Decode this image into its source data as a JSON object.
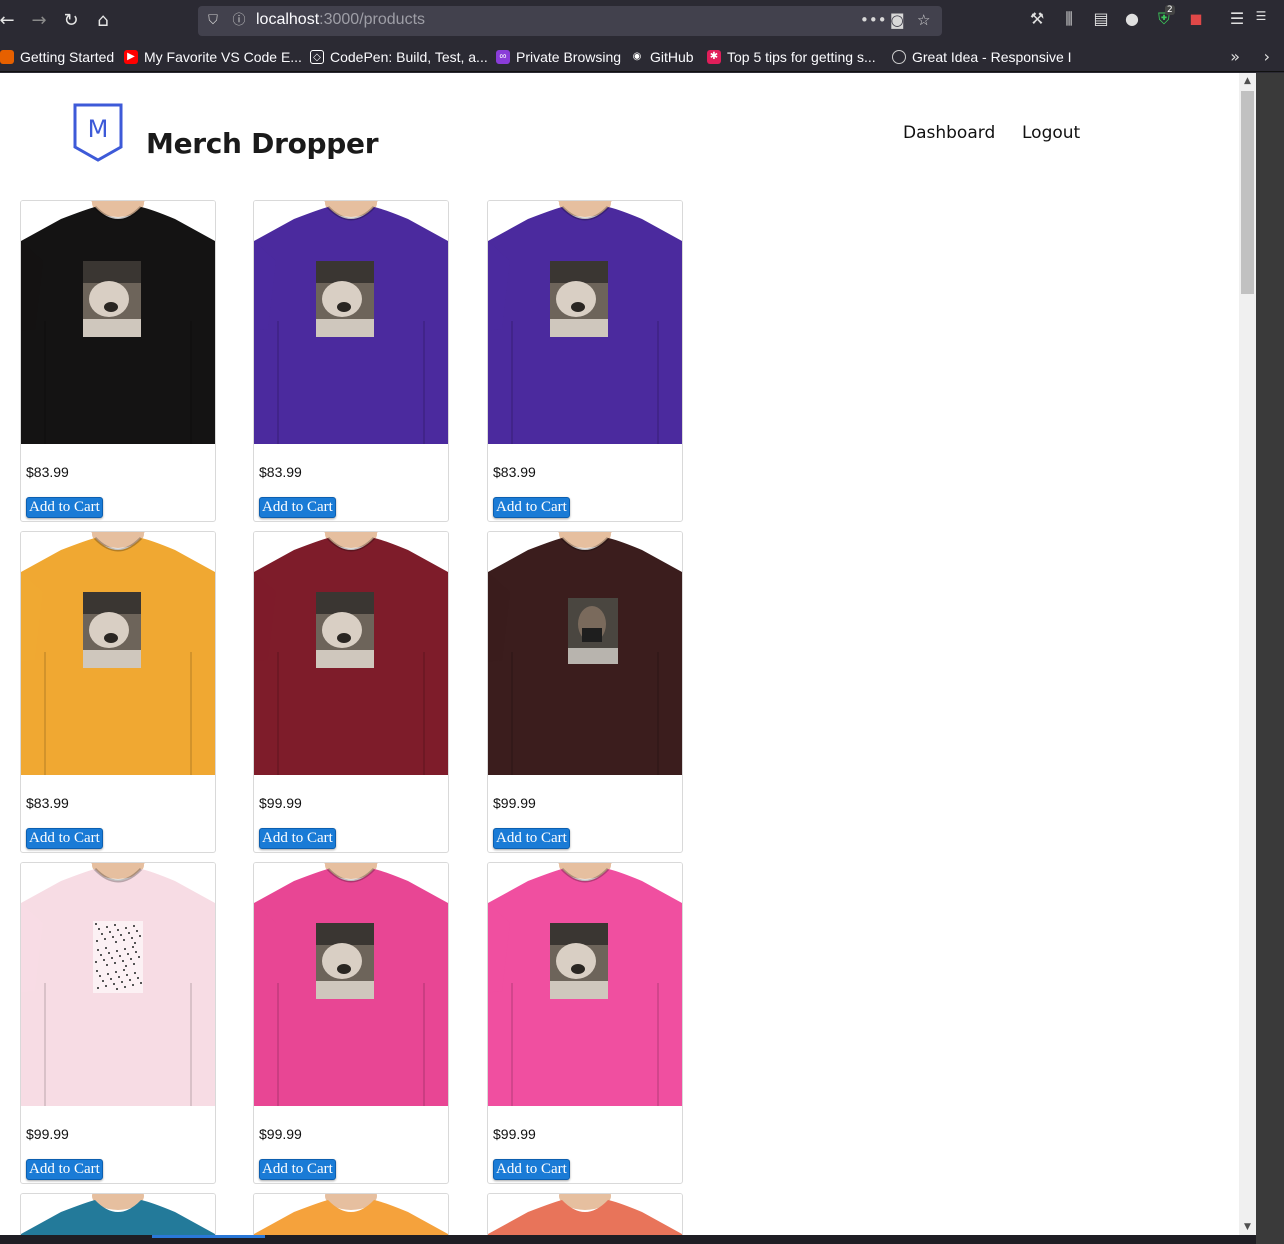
{
  "browser": {
    "url_host": "localhost",
    "url_path": ":3000/products",
    "extension_badge": "2",
    "bookmarks": [
      {
        "label": "Getting Started",
        "color": "#e66000"
      },
      {
        "label": "My Favorite VS Code E...",
        "color": "#ff0000"
      },
      {
        "label": "CodePen: Build, Test, a...",
        "color": "#ffffff"
      },
      {
        "label": "Private Browsing",
        "color": "#8a3cd8"
      },
      {
        "label": "GitHub",
        "color": "#ffffff"
      },
      {
        "label": "Top 5 tips for getting s...",
        "color": "#e01e5a"
      },
      {
        "label": "Great Idea - Responsive I",
        "color": "#cccccc"
      }
    ]
  },
  "header": {
    "logo_letter": "M",
    "brand": "Merch Dropper",
    "nav": [
      {
        "label": "Dashboard"
      },
      {
        "label": "Logout"
      }
    ]
  },
  "products": [
    {
      "price": "$83.99",
      "button": "Add to Cart",
      "shirt_color": "#141313",
      "design": "dog"
    },
    {
      "price": "$83.99",
      "button": "Add to Cart",
      "shirt_color": "#4b2a9e",
      "design": "dog"
    },
    {
      "price": "$83.99",
      "button": "Add to Cart",
      "shirt_color": "#4b2a9e",
      "design": "dog"
    },
    {
      "price": "$83.99",
      "button": "Add to Cart",
      "shirt_color": "#f0a832",
      "design": "dog"
    },
    {
      "price": "$99.99",
      "button": "Add to Cart",
      "shirt_color": "#7e1c2a",
      "design": "dog"
    },
    {
      "price": "$99.99",
      "button": "Add to Cart",
      "shirt_color": "#3b1d1d",
      "design": "person"
    },
    {
      "price": "$99.99",
      "button": "Add to Cart",
      "shirt_color": "#f7dce4",
      "design": "faded"
    },
    {
      "price": "$99.99",
      "button": "Add to Cart",
      "shirt_color": "#e84694",
      "design": "dog"
    },
    {
      "price": "$99.99",
      "button": "Add to Cart",
      "shirt_color": "#f04fa0",
      "design": "dog"
    }
  ],
  "partial_products": [
    {
      "shirt_color": "#237a9a"
    },
    {
      "shirt_color": "#f5a23c"
    },
    {
      "shirt_color": "#e8745a"
    }
  ]
}
